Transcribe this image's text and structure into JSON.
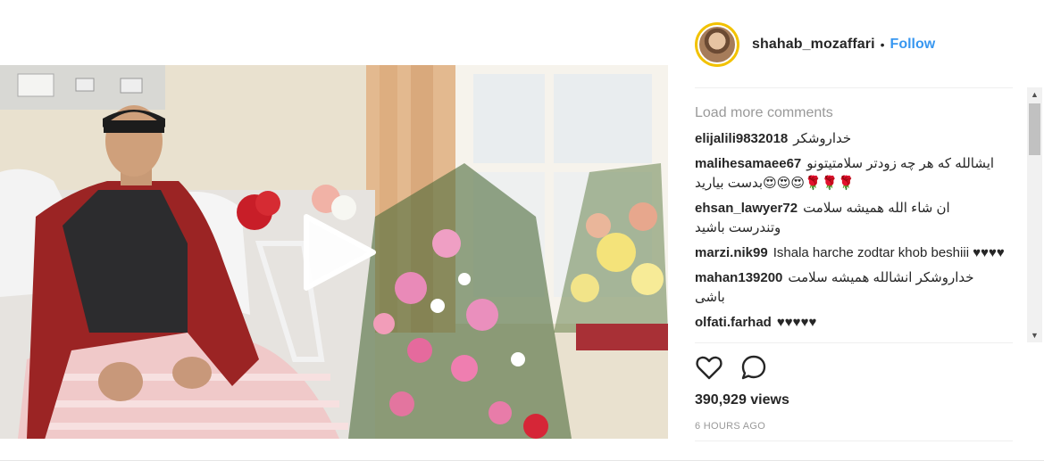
{
  "post": {
    "username": "shahab_mozaffari",
    "separator": "•",
    "follow_label": "Follow",
    "load_more_label": "Load more comments",
    "comments": [
      {
        "author": "elijalili9832018",
        "text": "خداروشکر"
      },
      {
        "author": "malihesamaee67",
        "text": "ایشالله که هر چه زودتر سلامتیتونو بدست بیارید😍😍😍🌹🌹🌹"
      },
      {
        "author": "ehsan_lawyer72",
        "text": "ان شاء الله همیشه سلامت وتندرست باشید"
      },
      {
        "author": "marzi.nik99",
        "text": "Ishala harche zodtar khob beshiii ♥♥♥♥"
      },
      {
        "author": "mahan139200",
        "text": "خداروشکر انشالله همیشه سلامت باشی"
      },
      {
        "author": "olfati.farhad",
        "text": "♥♥♥♥♥"
      }
    ],
    "views": "390,929 views",
    "time": "6 HOURS AGO"
  },
  "icons": {
    "like": "heart-icon",
    "comment": "comment-icon",
    "play": "play-icon"
  },
  "colors": {
    "accent": "#3897f0",
    "avatar_ring": "#f2c200",
    "muted": "#999999"
  }
}
